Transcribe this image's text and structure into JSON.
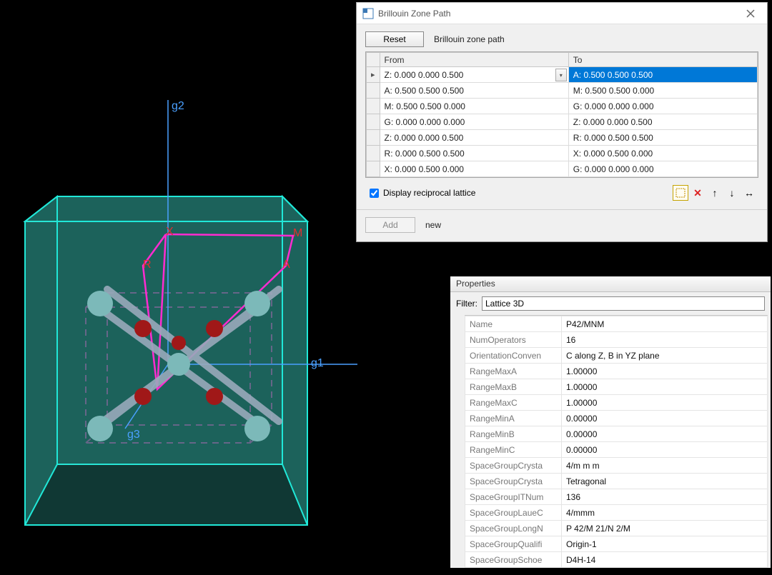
{
  "bz_dialog": {
    "title": "Brillouin Zone Path",
    "reset_label": "Reset",
    "path_label": "Brillouin zone path",
    "col_from": "From",
    "col_to": "To",
    "rows": [
      {
        "from": "Z:  0.000  0.000  0.500",
        "to": "A:  0.500  0.500  0.500",
        "selected": true,
        "marker": "▸"
      },
      {
        "from": "A:  0.500  0.500  0.500",
        "to": "M:  0.500  0.500  0.000"
      },
      {
        "from": "M:  0.500  0.500  0.000",
        "to": "G:  0.000  0.000  0.000"
      },
      {
        "from": "G:  0.000  0.000  0.000",
        "to": "Z:  0.000  0.000  0.500"
      },
      {
        "from": "Z:  0.000  0.000  0.500",
        "to": "R:  0.000  0.500  0.500"
      },
      {
        "from": "R:  0.000  0.500  0.500",
        "to": "X:  0.000  0.500  0.000"
      },
      {
        "from": "X:  0.000  0.500  0.000",
        "to": "G:  0.000  0.000  0.000"
      }
    ],
    "display_reciprocal_label": "Display reciprocal lattice",
    "display_reciprocal_checked": true,
    "add_label": "Add",
    "new_label": "new"
  },
  "properties": {
    "title": "Properties",
    "filter_label": "Filter:",
    "filter_value": "Lattice 3D",
    "rows": [
      {
        "key": "Name",
        "val": "P42/MNM"
      },
      {
        "key": "NumOperators",
        "val": "16"
      },
      {
        "key": "OrientationConven",
        "val": "C along Z, B in YZ plane"
      },
      {
        "key": "RangeMaxA",
        "val": "1.00000"
      },
      {
        "key": "RangeMaxB",
        "val": "1.00000"
      },
      {
        "key": "RangeMaxC",
        "val": "1.00000"
      },
      {
        "key": "RangeMinA",
        "val": "0.00000"
      },
      {
        "key": "RangeMinB",
        "val": "0.00000"
      },
      {
        "key": "RangeMinC",
        "val": "0.00000"
      },
      {
        "key": "SpaceGroupCrysta",
        "val": "4/m m m"
      },
      {
        "key": "SpaceGroupCrysta",
        "val": "Tetragonal"
      },
      {
        "key": "SpaceGroupITNum",
        "val": "136"
      },
      {
        "key": "SpaceGroupLaueC",
        "val": "4/mmm"
      },
      {
        "key": "SpaceGroupLongN",
        "val": "P 42/M 21/N 2/M"
      },
      {
        "key": "SpaceGroupQualifi",
        "val": "Origin-1"
      },
      {
        "key": "SpaceGroupSchoe",
        "val": "D4H-14"
      }
    ]
  },
  "viewport": {
    "axis_g1": "g1",
    "axis_g2": "g2",
    "axis_g3": "g3",
    "point_X": "X",
    "point_M": "M",
    "point_R": "R",
    "point_A": "A"
  }
}
